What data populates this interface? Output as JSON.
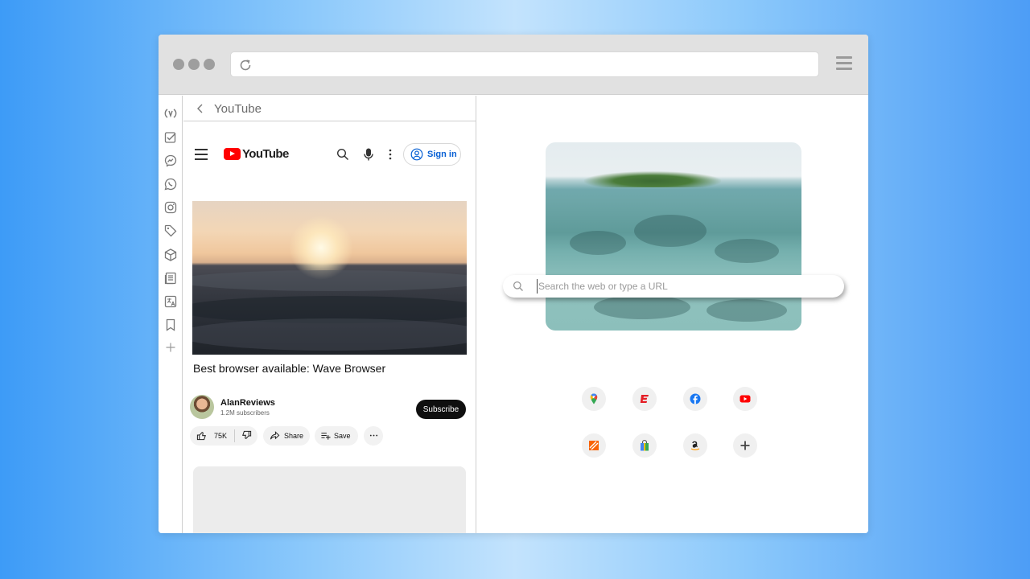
{
  "browser": {
    "url": "",
    "icons": {
      "reload": "reload-icon",
      "menu": "hamburger-menu-icon"
    }
  },
  "sidebar": {
    "items": [
      {
        "icon": "wave-logo-icon"
      },
      {
        "icon": "tasks-icon"
      },
      {
        "icon": "messenger-icon"
      },
      {
        "icon": "whatsapp-icon"
      },
      {
        "icon": "instagram-icon"
      },
      {
        "icon": "tag-icon"
      },
      {
        "icon": "package-icon"
      },
      {
        "icon": "news-icon"
      },
      {
        "icon": "translate-icon"
      },
      {
        "icon": "bookmark-icon"
      },
      {
        "icon": "plus-icon"
      }
    ]
  },
  "panel": {
    "title": "YouTube",
    "youtube": {
      "logo_text": "YouTube",
      "signin_label": "Sign in",
      "video": {
        "title": "Best browser available: Wave Browser",
        "channel_name": "AlanReviews",
        "subscribers": "1.2M subscribers",
        "subscribe_label": "Subscribe",
        "likes": "75K",
        "share_label": "Share",
        "save_label": "Save"
      }
    }
  },
  "newtab": {
    "search_placeholder": "Search the web or type a URL",
    "shortcuts": [
      {
        "name": "google-maps",
        "icon": "google-maps-icon"
      },
      {
        "name": "espn",
        "icon": "espn-icon"
      },
      {
        "name": "facebook",
        "icon": "facebook-icon"
      },
      {
        "name": "youtube",
        "icon": "youtube-icon"
      },
      {
        "name": "home-depot",
        "icon": "home-depot-icon"
      },
      {
        "name": "shopping",
        "icon": "shopping-bag-icon"
      },
      {
        "name": "amazon",
        "icon": "amazon-icon"
      },
      {
        "name": "add-shortcut",
        "icon": "plus-icon"
      }
    ]
  },
  "colors": {
    "youtube_red": "#ff0000",
    "signin_blue": "#065fd4",
    "facebook_blue": "#1877f2",
    "espn_red": "#e41e26",
    "home_depot_orange": "#f96302"
  }
}
